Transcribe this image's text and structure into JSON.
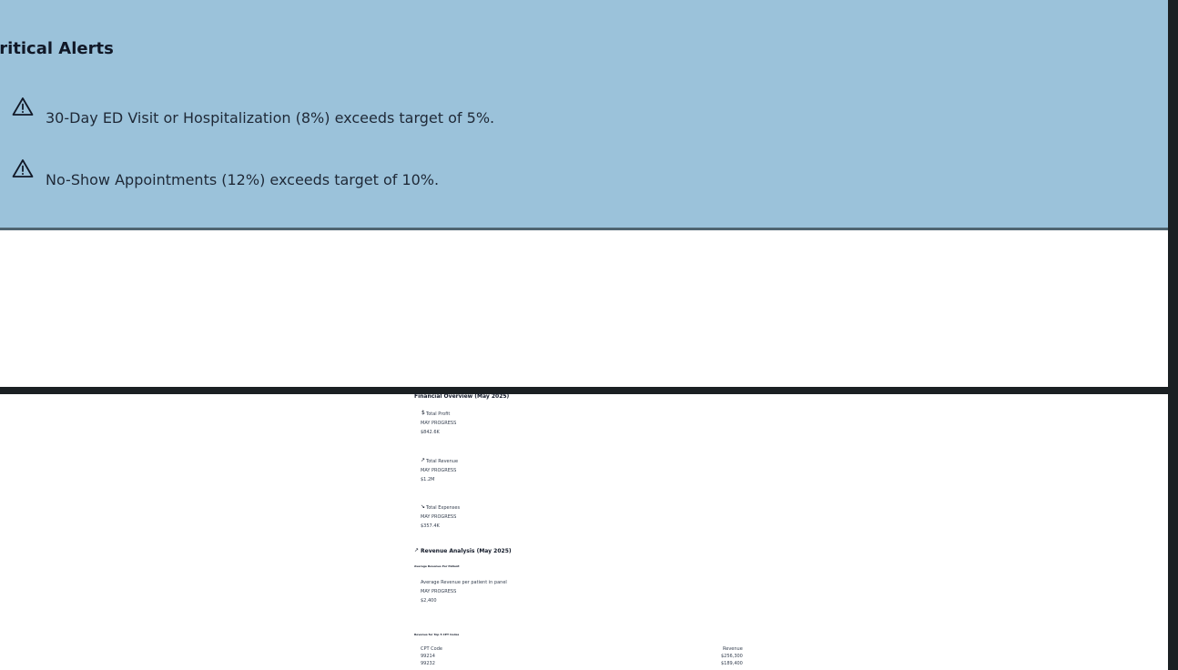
{
  "alerts": {
    "title": "Critical Alerts",
    "items": [
      {
        "icon": "warning-triangle-icon",
        "text": "30-Day ED Visit or Hospitalization (8%) exceeds target of 5%."
      },
      {
        "icon": "warning-triangle-icon",
        "text": "No-Show Appointments (12%) exceeds target of 10%."
      }
    ]
  },
  "financial": {
    "title": "Financial Overview (May 2025)",
    "cards": [
      {
        "icon": "dollar-icon",
        "icon_glyph": "$",
        "label": "Total Profit",
        "sub": "MAY PROGRESS",
        "value": "$842.6K"
      },
      {
        "icon": "trend-up-icon",
        "icon_glyph": "↗",
        "label": "Total Revenue",
        "sub": "MAY PROGRESS",
        "value": "$1.2M"
      },
      {
        "icon": "trend-down-icon",
        "icon_glyph": "↘",
        "label": "Total Expenses",
        "sub": "MAY PROGRESS",
        "value": "$357.4K"
      }
    ]
  },
  "revenue": {
    "title": "Revenue Analysis (May 2025)",
    "icon": "trend-up-icon",
    "icon_glyph": "↗",
    "avg_section": "Average Revenue Per Patient",
    "avg_card": {
      "label": "Average Revenue per patient in panel",
      "sub": "MAY PROGRESS",
      "value": "$2,400"
    },
    "cpt_section": "Revenue for Top 5 CPT Codes",
    "cpt_table": {
      "headers": [
        "CPT Code",
        "Revenue"
      ],
      "rows": [
        [
          "99214",
          "$256,300"
        ],
        [
          "99232",
          "$189,400"
        ]
      ]
    }
  },
  "colors": {
    "alerts_bg": "#9bc2da",
    "alerts_border": "#4f6470",
    "dark_strip": "#1b2023"
  }
}
